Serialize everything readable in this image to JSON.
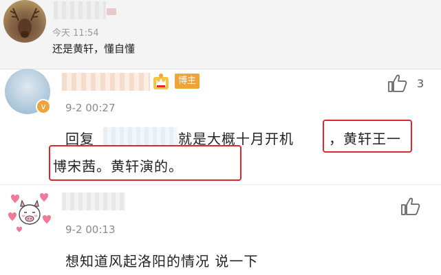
{
  "comment_top": {
    "time": "今天 11:54",
    "text": "还是黄轩，懂自懂"
  },
  "reply_comment": {
    "badge": "博主",
    "badge_color": "#f0a33a",
    "time": "9-2 00:27",
    "like_count": "3",
    "text_prefix": "回复",
    "text_middle": "就是大概十月开机",
    "text_highlight_1": "，黄轩王一",
    "text_highlight_2": "博宋茜。黄轩演的。",
    "highlight_color": "#e0262a"
  },
  "comment_bottom": {
    "time": "9-2 00:13",
    "text": "想知道风起洛阳的情况 说一下"
  },
  "icons": [
    "crown-icon",
    "verified-icon",
    "like-icon"
  ]
}
